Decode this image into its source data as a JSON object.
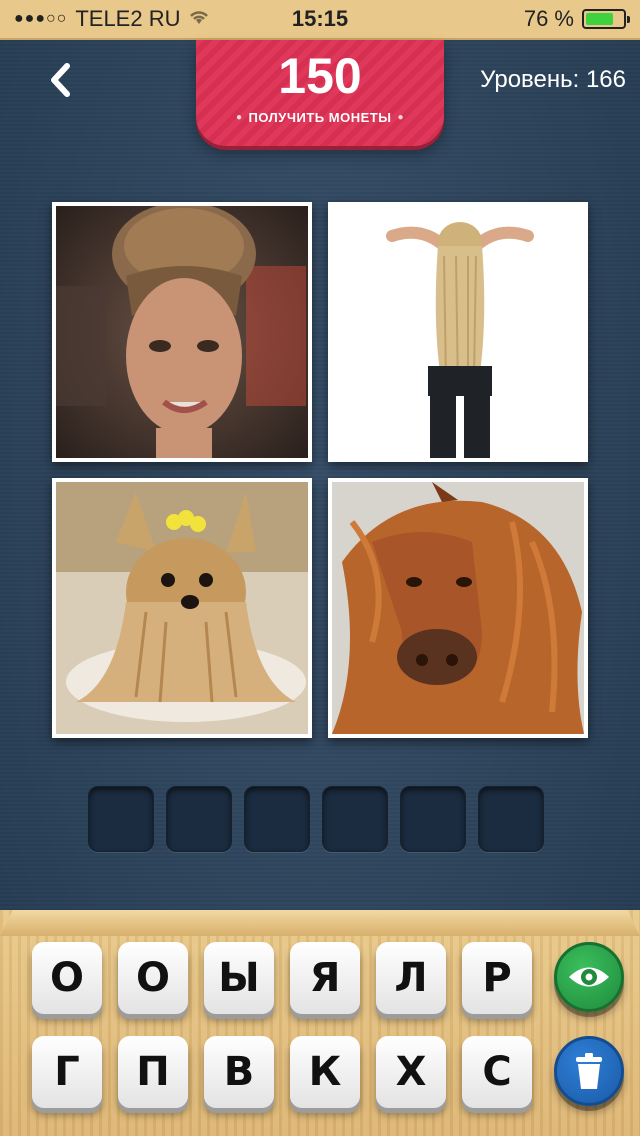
{
  "status_bar": {
    "carrier": "TELE2 RU",
    "time": "15:15",
    "battery": "76 %",
    "battery_level": 0.76
  },
  "header": {
    "coins": "150",
    "get_coins_label": "ПОЛУЧИТЬ МОНЕТЫ",
    "level": "Уровень: 166"
  },
  "answer": {
    "slots": 6
  },
  "keyboard": {
    "row1": [
      "О",
      "О",
      "Ы",
      "Я",
      "Л",
      "Р"
    ],
    "row2": [
      "Г",
      "П",
      "В",
      "К",
      "Х",
      "С"
    ]
  },
  "colors": {
    "ribbon": "#e0385a",
    "background": "#2e4560",
    "tray": "#e9c98a",
    "hint_button": "#2aa84b",
    "delete_button": "#2471c2"
  },
  "icons": {
    "back": "chevron-left-icon",
    "hint": "eye-icon",
    "delete": "trash-icon"
  }
}
